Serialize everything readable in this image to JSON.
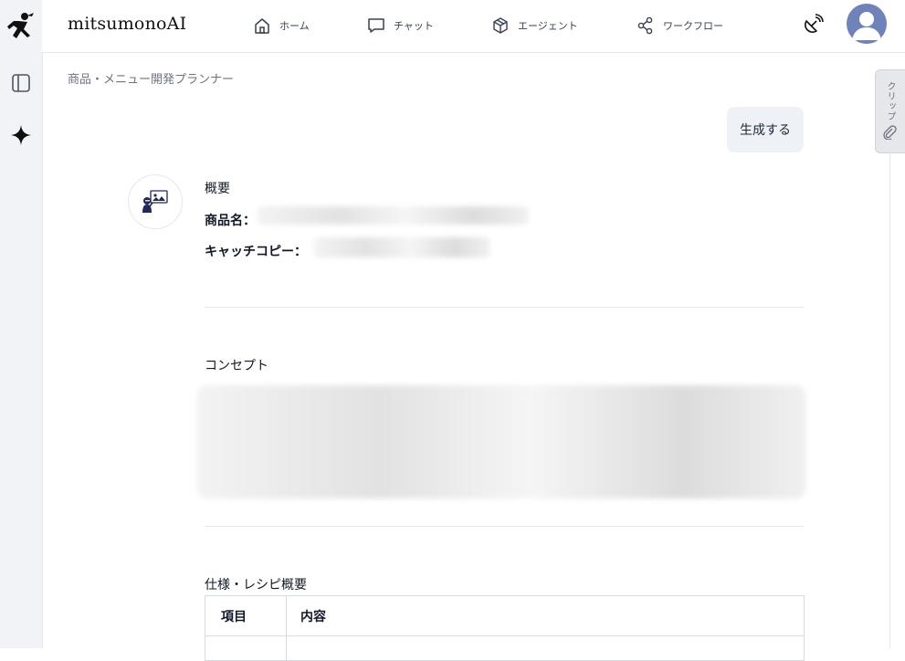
{
  "header": {
    "brand": "mitsumonoAI",
    "nav": [
      {
        "label": "ホーム",
        "icon": "home-icon"
      },
      {
        "label": "チャット",
        "icon": "chat-icon"
      },
      {
        "label": "エージェント",
        "icon": "cube-icon"
      },
      {
        "label": "ワークフロー",
        "icon": "share-icon"
      }
    ]
  },
  "breadcrumb": "商品・メニュー開発プランナー",
  "clip_panel": {
    "label": "クリップ"
  },
  "chat": {
    "user_message": "生成する",
    "response": {
      "overview_heading": "概要",
      "product_name_label": "商品名：",
      "catchcopy_label": "キャッチコピー：",
      "concept_heading": "コンセプト",
      "spec_heading": "仕様・レシピ概要",
      "table_headers": [
        "項目",
        "内容"
      ]
    }
  },
  "colors": {
    "rail_bg": "#f2f3f6",
    "avatar_bg": "#6f82b9",
    "bubble_bg": "#eef1f6"
  }
}
